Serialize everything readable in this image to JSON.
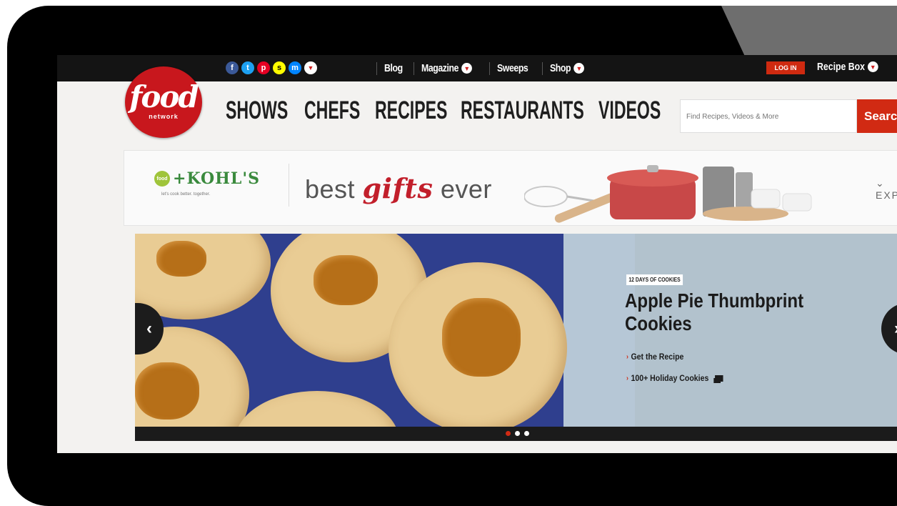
{
  "topbar": {
    "social_icons": [
      {
        "name": "facebook-icon",
        "glyph": "f",
        "color": "#3b5998"
      },
      {
        "name": "twitter-icon",
        "glyph": "t",
        "color": "#1da1f2"
      },
      {
        "name": "pinterest-icon",
        "glyph": "p",
        "color": "#e60023"
      },
      {
        "name": "snapchat-icon",
        "glyph": "s",
        "color": "#fffc00"
      },
      {
        "name": "messenger-icon",
        "glyph": "m",
        "color": "#0084ff"
      }
    ],
    "links": [
      {
        "label": "Blog",
        "dropdown": false
      },
      {
        "label": "Magazine",
        "dropdown": true
      },
      {
        "label": "Sweeps",
        "dropdown": false
      },
      {
        "label": "Shop",
        "dropdown": true
      }
    ],
    "login_label": "LOG IN",
    "recipe_box_label": "Recipe Box"
  },
  "logo": {
    "wordmark": "food",
    "subtext": "network",
    "color": "#c8171d"
  },
  "main_nav": [
    "SHOWS",
    "CHEFS",
    "RECIPES",
    "RESTAURANTS",
    "VIDEOS"
  ],
  "search": {
    "placeholder": "Find Recipes, Videos & More",
    "button_label": "Searc"
  },
  "ad": {
    "brand": "KOHL'S",
    "food_badge": "food",
    "tagline": "let's cook better. together.",
    "headline_before": "best ",
    "headline_emph": "gifts",
    "headline_after": " ever",
    "expand_label": "EXPAND"
  },
  "hero": {
    "label": "12 DAYS OF COOKIES",
    "title": "Apple Pie Thumbprint Cookies",
    "links": [
      "Get the Recipe",
      "100+ Holiday Cookies"
    ],
    "prev_arrow": "‹",
    "next_arrow": "›",
    "dots": 3,
    "active_dot": 0
  },
  "colors": {
    "accent": "#d12a13",
    "topbar_bg": "#141414",
    "page_bg": "#f3f2f0"
  }
}
